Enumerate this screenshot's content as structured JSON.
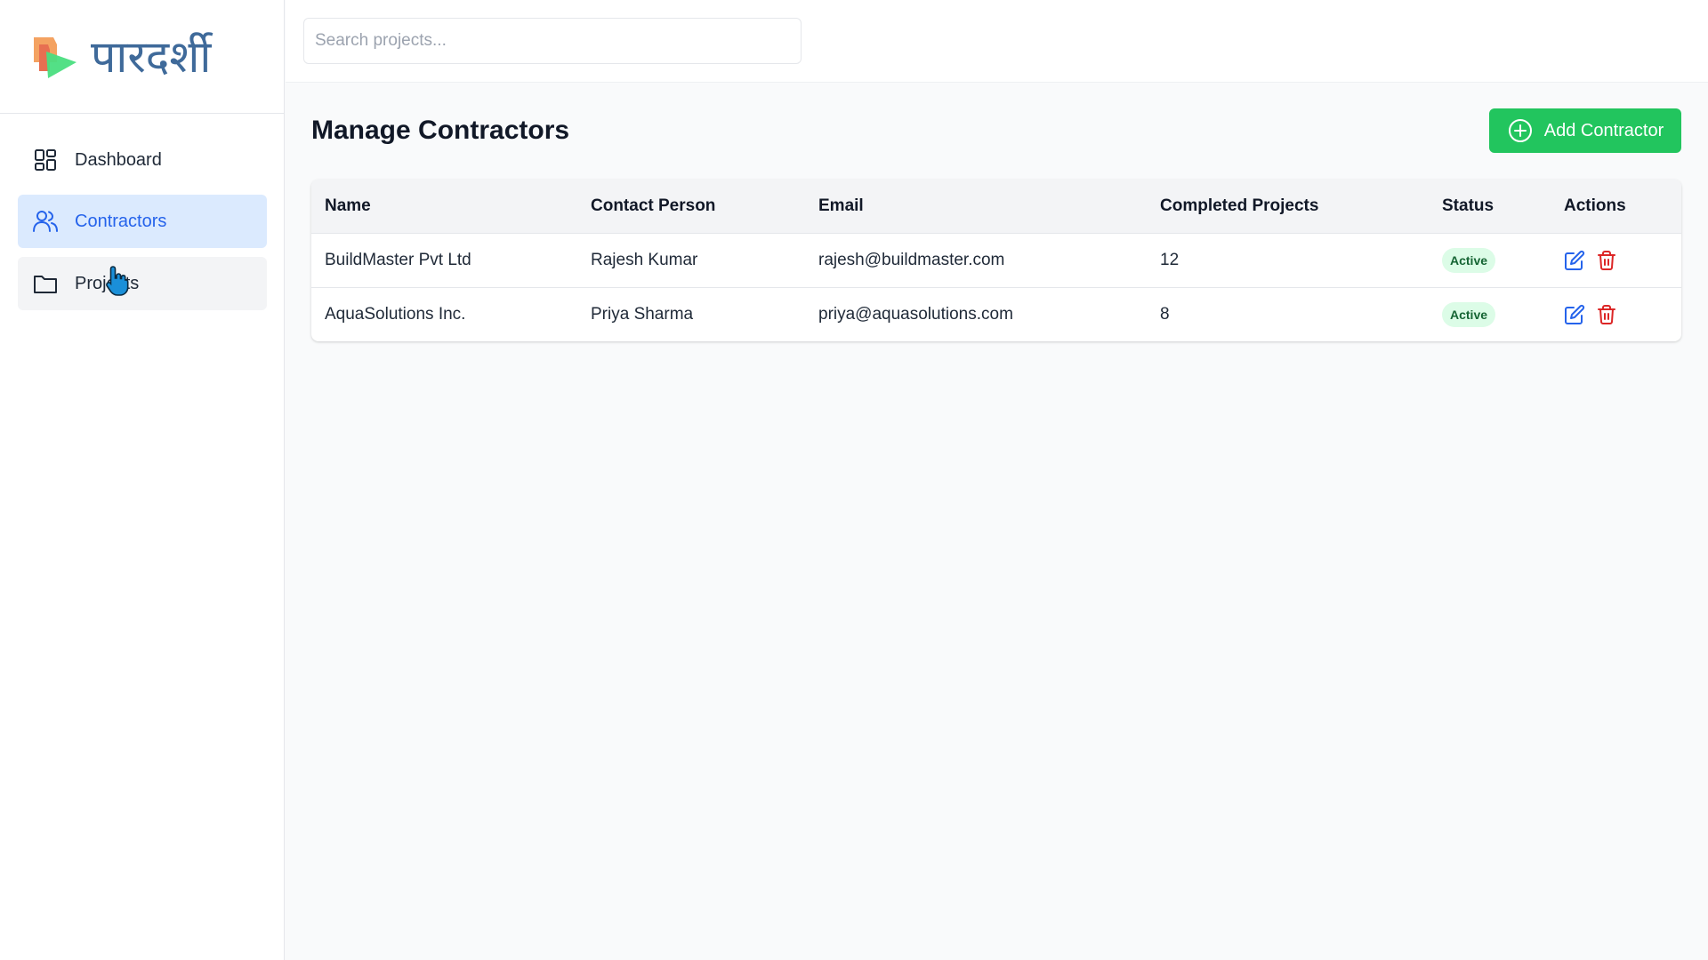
{
  "app": {
    "logo_text": "पारदर्शी"
  },
  "sidebar": {
    "items": [
      {
        "label": "Dashboard",
        "icon": "dashboard-grid-icon"
      },
      {
        "label": "Contractors",
        "icon": "users-icon",
        "active": true
      },
      {
        "label": "Projects",
        "icon": "folder-icon"
      }
    ]
  },
  "search": {
    "placeholder": "Search projects...",
    "value": ""
  },
  "main": {
    "title": "Manage Contractors",
    "add_button_label": "Add Contractor"
  },
  "table": {
    "columns": [
      "Name",
      "Contact Person",
      "Email",
      "Completed Projects",
      "Status",
      "Actions"
    ],
    "rows": [
      {
        "name": "BuildMaster Pvt Ltd",
        "contact": "Rajesh Kumar",
        "email": "rajesh@buildmaster.com",
        "completed": "12",
        "status": "Active"
      },
      {
        "name": "AquaSolutions Inc.",
        "contact": "Priya Sharma",
        "email": "priya@aquasolutions.com",
        "completed": "8",
        "status": "Active"
      }
    ]
  },
  "colors": {
    "accent_blue": "#2563eb",
    "active_bg": "#dbeafe",
    "add_button": "#22c55e",
    "status_active_bg": "#dcfce7",
    "status_active_text": "#166534",
    "delete_red": "#dc2626",
    "logo_text": "#3f6a9a"
  }
}
